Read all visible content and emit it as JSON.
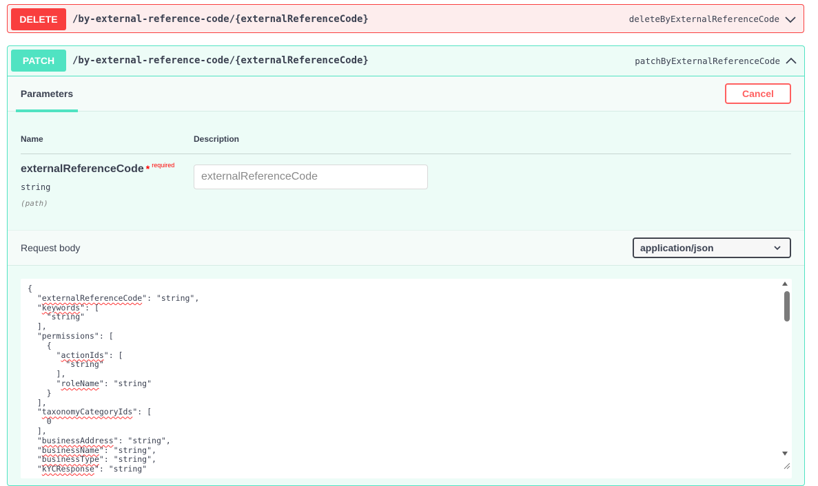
{
  "delete_op": {
    "method": "DELETE",
    "path": "/by-external-reference-code/{externalReferenceCode}",
    "operation_id": "deleteByExternalReferenceCode",
    "expanded_icon": "chevron-down-icon"
  },
  "patch_op": {
    "method": "PATCH",
    "path": "/by-external-reference-code/{externalReferenceCode}",
    "operation_id": "patchByExternalReferenceCode",
    "expanded_icon": "chevron-up-icon",
    "tabs": {
      "parameters": "Parameters"
    },
    "cancel_label": "Cancel",
    "columns": {
      "name": "Name",
      "description": "Description"
    },
    "parameter": {
      "name": "externalReferenceCode",
      "star": "*",
      "required_label": "required",
      "type": "string",
      "in": "(path)",
      "placeholder": "externalReferenceCode"
    },
    "request_body": {
      "label": "Request body",
      "content_type": "application/json"
    }
  },
  "colors": {
    "delete": "#f93e3e",
    "delete_bg": "#fdeded",
    "patch": "#50e3c2",
    "patch_bg": "#edfcf7",
    "cancel": "#ff6060"
  }
}
